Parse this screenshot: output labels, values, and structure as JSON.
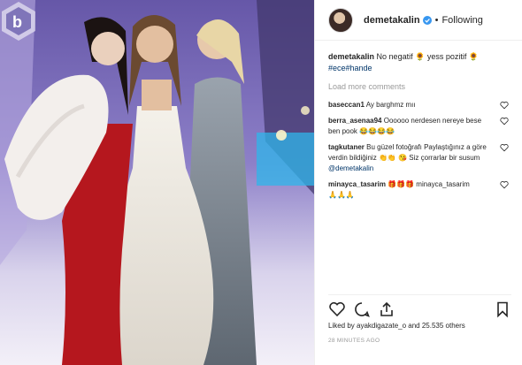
{
  "header": {
    "username": "demetakalin",
    "separator": "•",
    "follow_status": "Following"
  },
  "caption": {
    "username": "demetakalin",
    "text": "No negatif",
    "text2": "yess pozitif",
    "hashtags": "#ece#hande"
  },
  "load_more": "Load more comments",
  "comments": [
    {
      "user": "baseccan1",
      "text": "Ay barghmz mıı"
    },
    {
      "user": "berra_asenaa94",
      "text": "Oooooo nerdesen nereye bese ben pook"
    },
    {
      "user": "tagkutaner",
      "text": "Bu güzel fotoğrafı Paylaştığınız a göre verdin bildiğiniz",
      "text2": "Siz çorrarlar bir susum",
      "mention": "@demetakalin"
    },
    {
      "user": "minayca_tasarim",
      "text": "minayca_tasarim"
    }
  ],
  "likes": {
    "text": "Liked by ayakdigazate_o and 25.535 others"
  },
  "timestamp": "28 MINUTES AGO",
  "icons": {
    "verified": "verified-badge-icon",
    "heart": "heart-icon",
    "comment": "comment-icon",
    "share": "share-icon",
    "bookmark": "bookmark-icon"
  },
  "colors": {
    "verified": "#3897f0",
    "hashtag": "#003569",
    "muted": "#999999"
  }
}
